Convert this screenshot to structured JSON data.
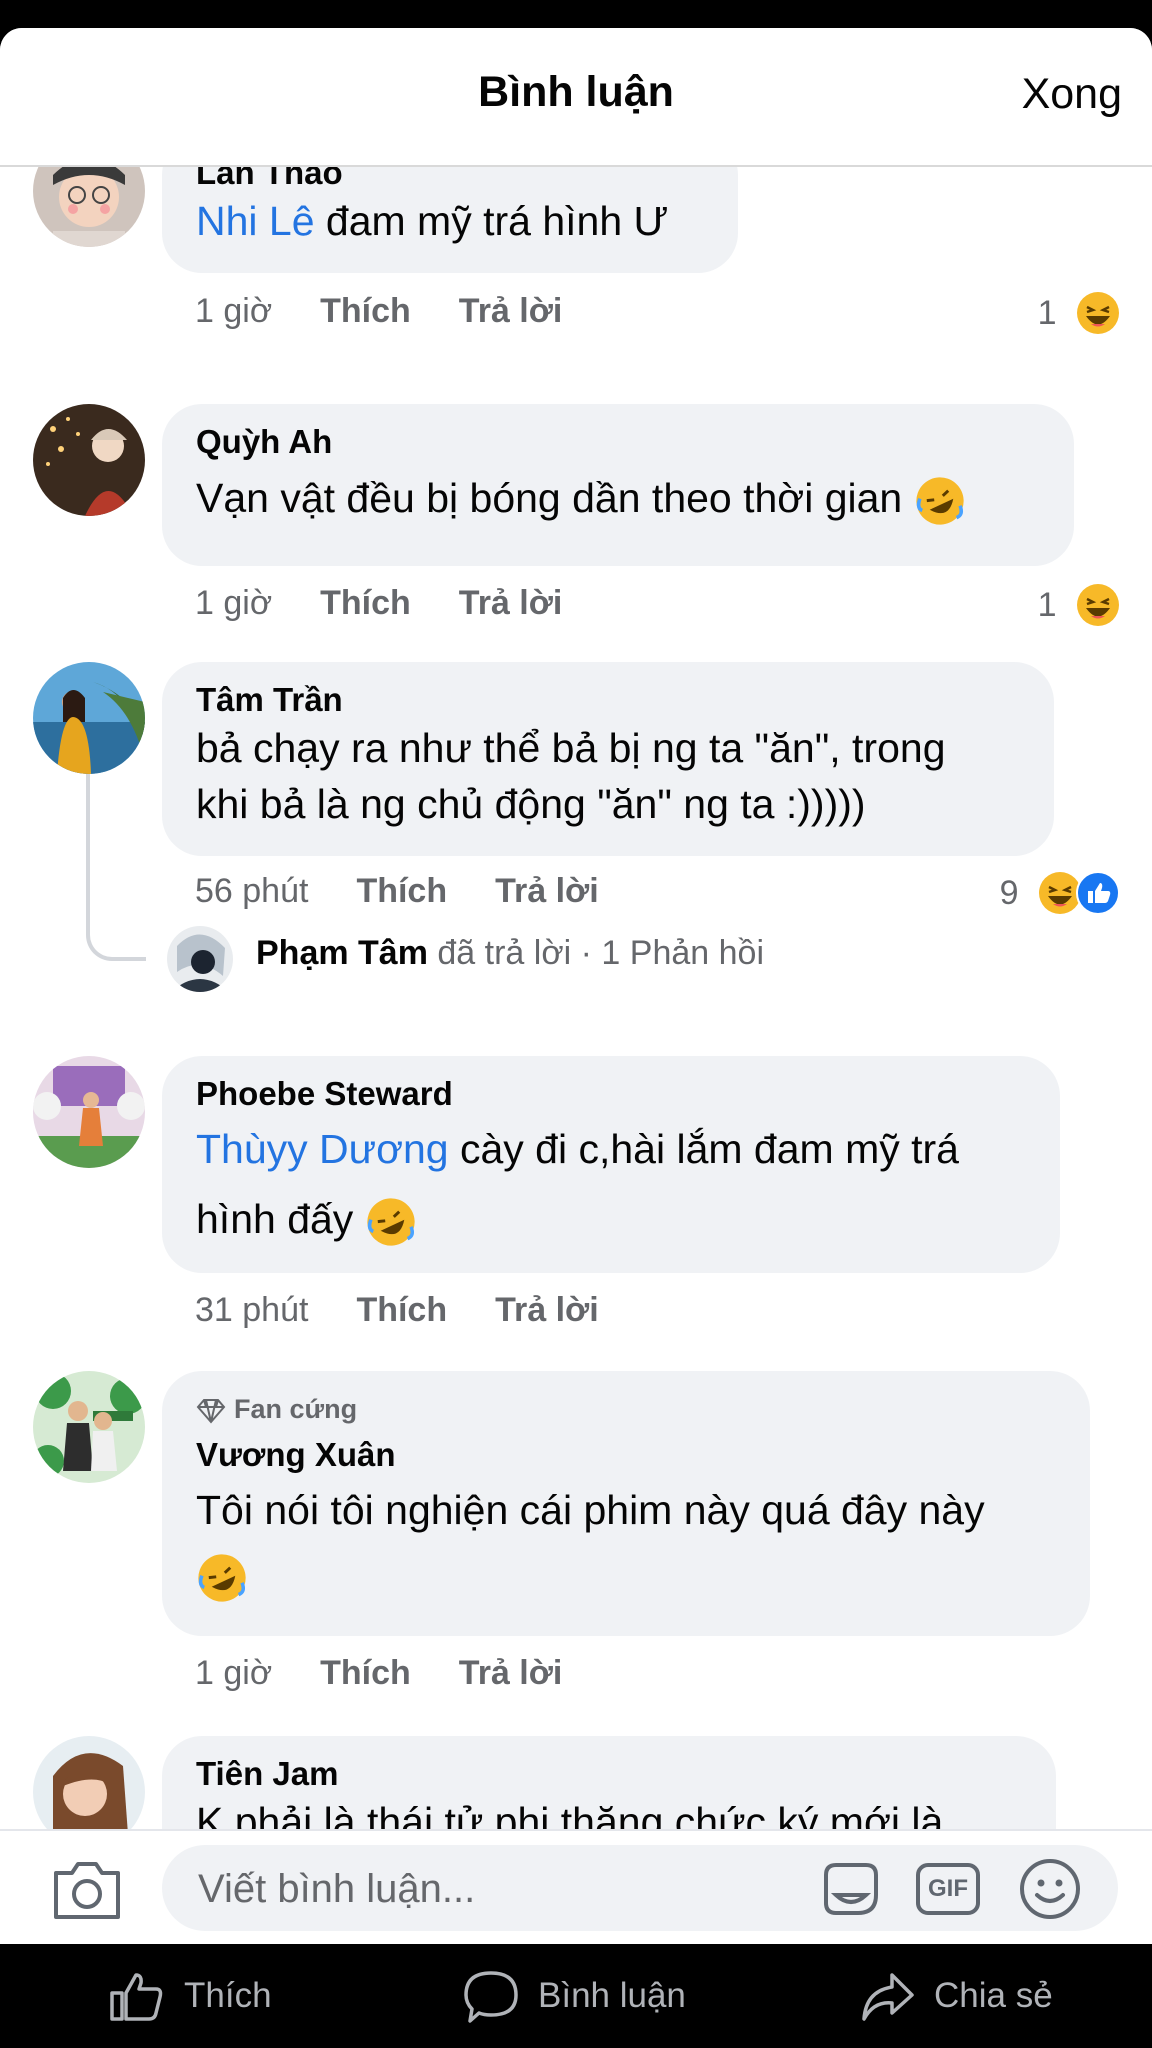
{
  "header": {
    "title": "Bình luận",
    "done": "Xong"
  },
  "comments": [
    {
      "author": "Lan Thảo",
      "mention": "Nhi Lê",
      "text": " đam mỹ trá hình Ư",
      "time": "1 giờ",
      "like": "Thích",
      "reply": "Trả lời",
      "reaction_count": "1"
    },
    {
      "author": "Quỳh Ah",
      "text": "Vạn vật đều bị bóng dần theo thời gian",
      "time": "1 giờ",
      "like": "Thích",
      "reply": "Trả lời",
      "reaction_count": "1"
    },
    {
      "author": "Tâm Trần",
      "text_line1": "bả chạy ra như thể bả bị ng ta \"ăn\", trong",
      "text_line2": "khi bả là ng chủ động \"ăn\" ng ta :)))))",
      "time": "56 phút",
      "like": "Thích",
      "reply": "Trả lời",
      "reaction_count": "9",
      "reply_summary": {
        "name": "Phạm Tâm",
        "action": " đã trả lời",
        "count": " · 1 Phản hồi"
      }
    },
    {
      "author": "Phoebe Steward",
      "mention": "Thùyy Dương",
      "text_line1": " cày đi c,hài lắm đam mỹ trá",
      "text_line2": "hình đấy",
      "time": "31 phút",
      "like": "Thích",
      "reply": "Trả lời"
    },
    {
      "badge": "Fan cứng",
      "author": "Vương Xuân",
      "text_line1": "Tôi nói tôi nghiện cái phim này quá đây này",
      "time": "1 giờ",
      "like": "Thích",
      "reply": "Trả lời"
    },
    {
      "author": "Tiên Jam",
      "text": "K phải là thái tử phi thăng chức ký mới là"
    }
  ],
  "composer": {
    "placeholder": "Viết bình luận...",
    "gif_label": "GIF"
  },
  "tabbar": {
    "like": "Thích",
    "comment": "Bình luận",
    "share": "Chia sẻ"
  },
  "colors": {
    "mention": "#2374e1",
    "bubble": "#f0f2f5",
    "meta": "#65676b",
    "like_blue": "#1877f2",
    "haha_yellow": "#f7b928"
  }
}
